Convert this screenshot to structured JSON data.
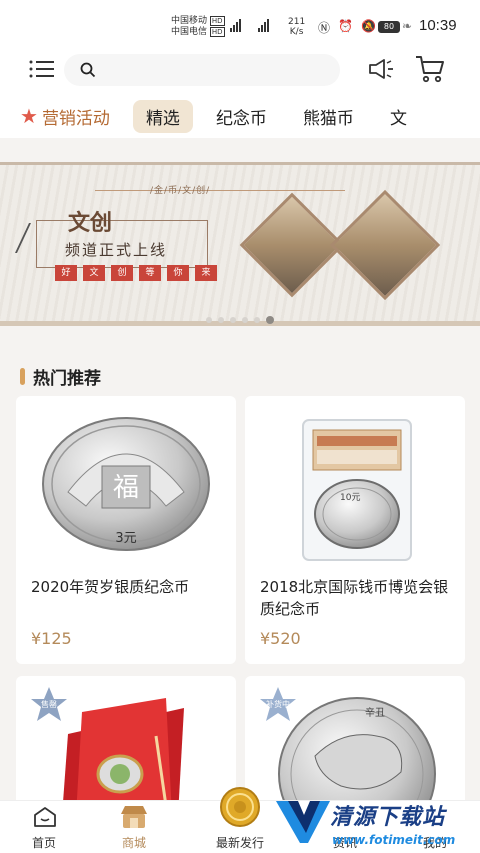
{
  "status_bar": {
    "carrier_1": "中国移动",
    "carrier_2": "中国电信",
    "hd": "HD",
    "net_speed_value": "211",
    "net_speed_unit": "K/s",
    "battery": "80",
    "time": "10:39"
  },
  "header": {
    "search_placeholder": ""
  },
  "tabs": [
    {
      "label": "营销活动",
      "active": false
    },
    {
      "label": "精选",
      "active": true
    },
    {
      "label": "纪念币",
      "active": false
    },
    {
      "label": "熊猫币",
      "active": false
    },
    {
      "label": "文",
      "active": false
    }
  ],
  "banner": {
    "tag": "/金/币/文/创/",
    "title_main": "文创",
    "title_sub": "频道正式上线",
    "seals": [
      "好",
      "文",
      "创",
      "等",
      "你",
      "来"
    ],
    "page_count": 6,
    "active_page": 6
  },
  "section": {
    "title": "热门推荐"
  },
  "products": [
    {
      "name": "2020年贺岁银质纪念币",
      "price": "¥125",
      "badge": ""
    },
    {
      "name": "2018北京国际钱币博览会银质纪念币",
      "price": "¥520",
      "badge": ""
    },
    {
      "name": "",
      "price": "",
      "badge": "售罄"
    },
    {
      "name": "",
      "price": "",
      "badge": "补货中"
    }
  ],
  "coin_labels": {
    "coin1_denomination": "3元",
    "coin2_denomination": "10元",
    "coin4_text": "辛丑"
  },
  "bottom_nav": [
    {
      "label": "首页",
      "icon": "home-icon",
      "active": false
    },
    {
      "label": "商城",
      "icon": "shop-icon",
      "active": true
    },
    {
      "label": "最新发行",
      "icon": "coin-icon",
      "active": false
    },
    {
      "label": "资讯",
      "icon": "news-icon",
      "active": false
    },
    {
      "label": "我的",
      "icon": "profile-icon",
      "active": false
    }
  ],
  "watermark": {
    "line1": "清源下载站",
    "line2": "www.fotimeit.com"
  },
  "colors": {
    "accent": "#b48a5a",
    "tab_active_bg": "#f1e5d3",
    "promo": "#b46a33",
    "star": "#e05b4b",
    "section_bar": "#d8a15d"
  }
}
